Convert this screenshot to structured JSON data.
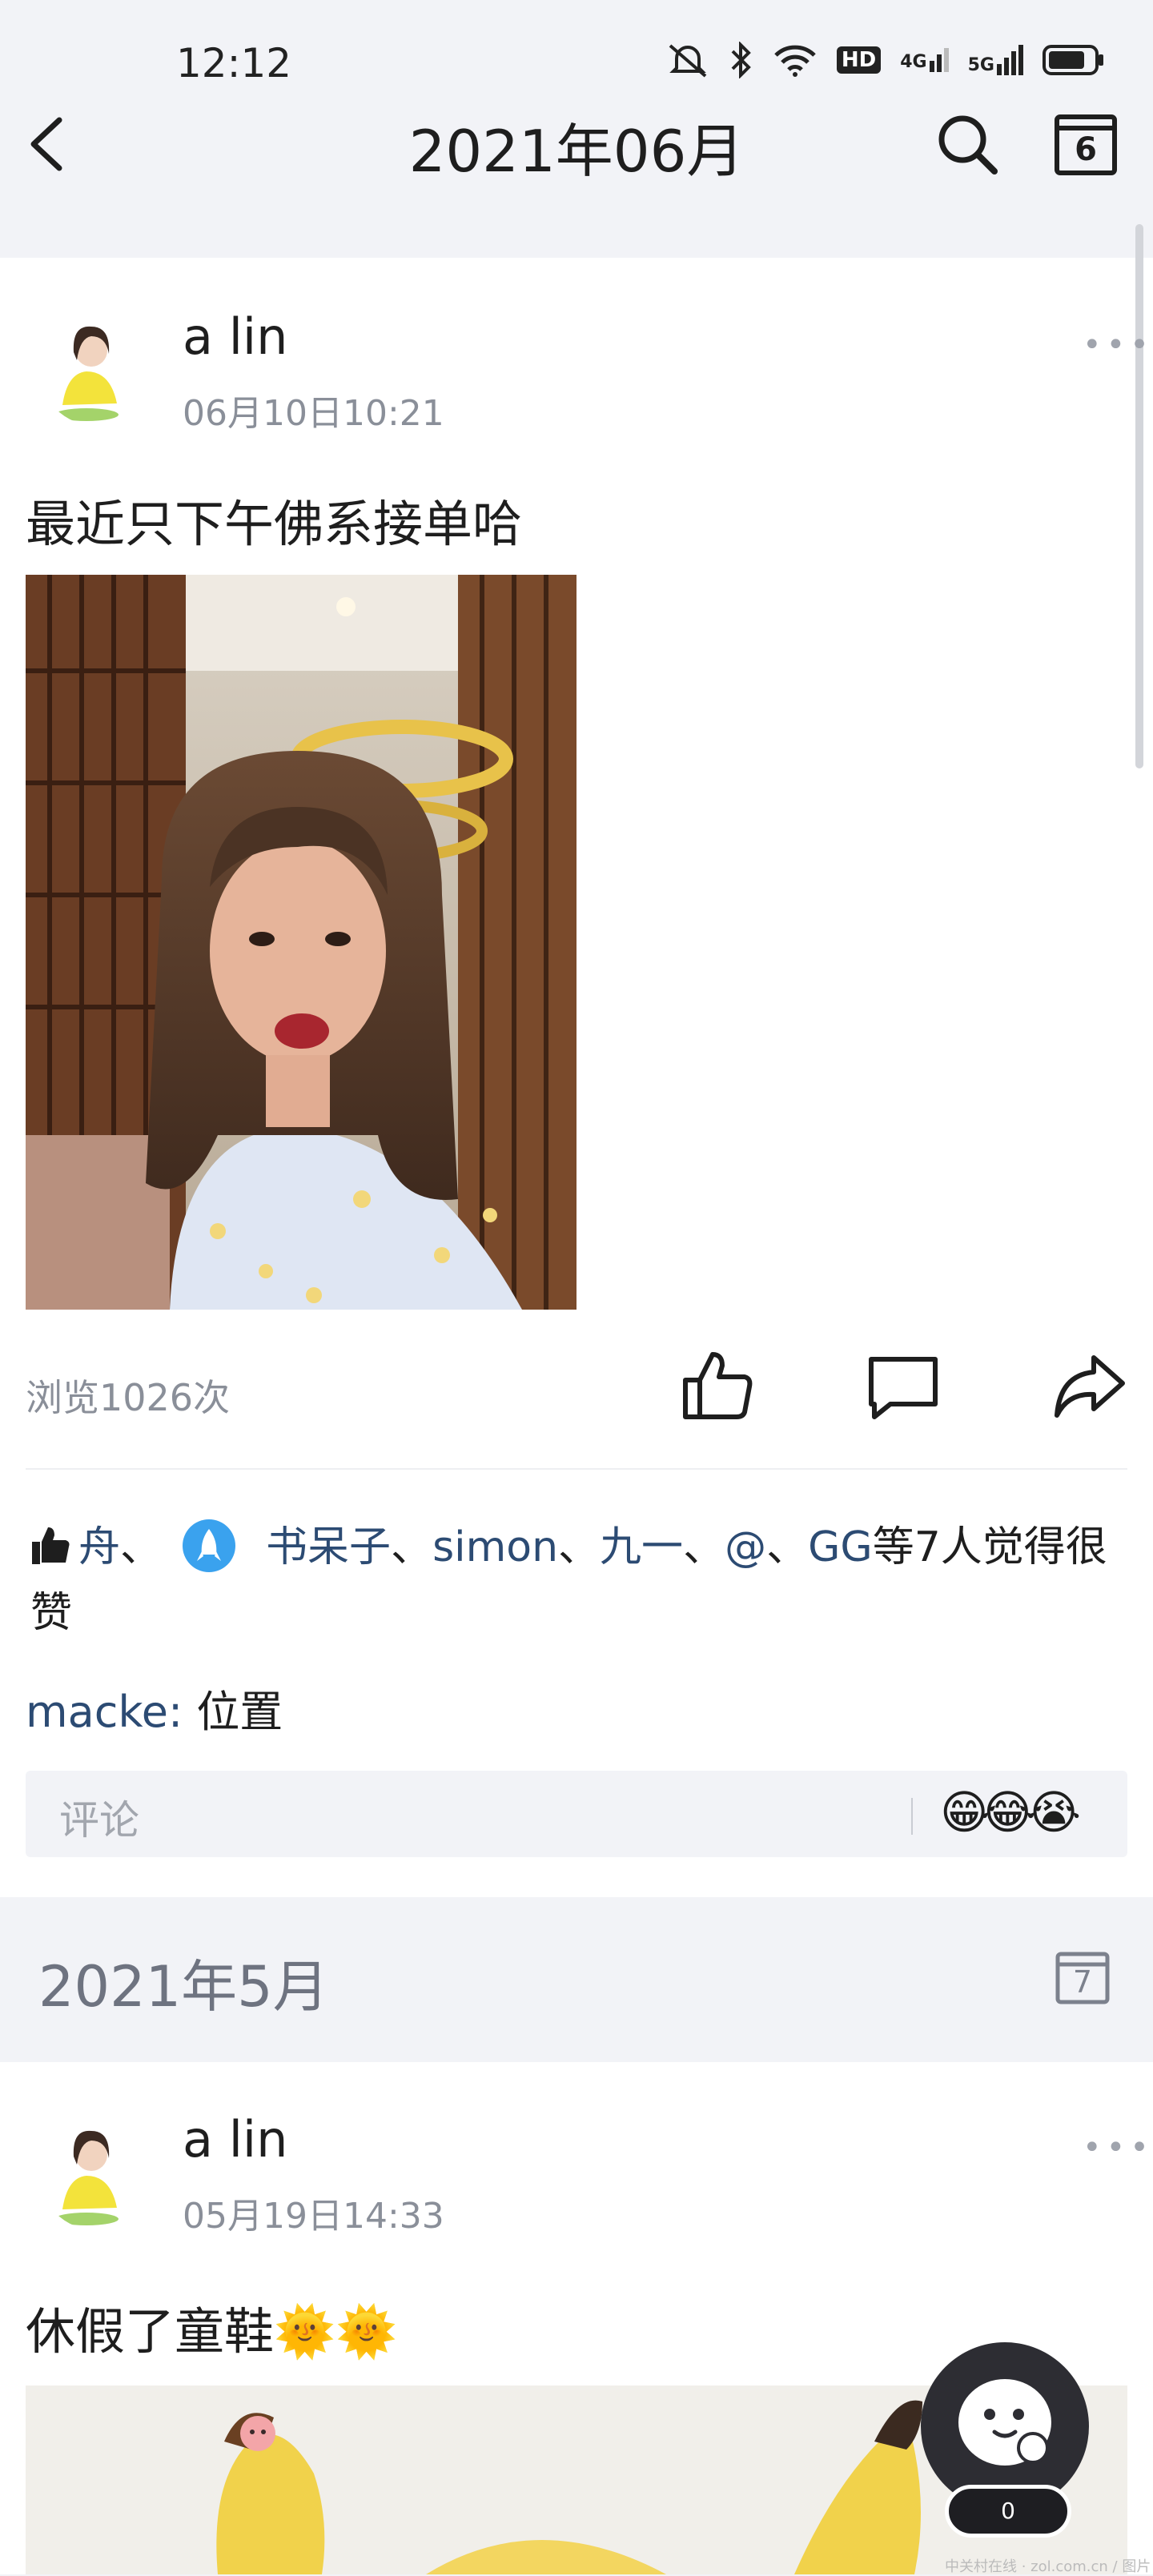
{
  "status_bar": {
    "time": "12:12",
    "icons": [
      "mute-bell-icon",
      "bluetooth-icon",
      "wifi-icon",
      "hd-icon",
      "4g-signal-icon",
      "5g-signal-icon",
      "battery-icon"
    ],
    "hd_label": "HD",
    "g4_label": "4G",
    "g5_label": "5G"
  },
  "header": {
    "title": "2021年06月",
    "calendar_day": "6"
  },
  "post1": {
    "username": "a lin",
    "date": "06月10日10:21",
    "more": "•••",
    "text": "最近只下午佛系接单哈",
    "views": "浏览1026次",
    "likers": [
      "舟",
      "书呆子",
      "simon",
      "九一",
      "@",
      "GG"
    ],
    "separator": "、",
    "likers_suffix": "等7人觉得很赞",
    "comment_user": "macke",
    "comment_colon": ": ",
    "comment_text": "位置",
    "comment_placeholder": "评论",
    "emojis": "😁😂😭"
  },
  "month_section": {
    "title": "2021年5月",
    "calendar_day": "7"
  },
  "post2": {
    "username": "a lin",
    "date": "05月19日14:33",
    "more": "•••",
    "text": "休假了童鞋",
    "text_emojis": "🌞🌞"
  },
  "fab": {
    "count": "0"
  },
  "watermark": "中关村在线 · zol.com.cn / 图片"
}
